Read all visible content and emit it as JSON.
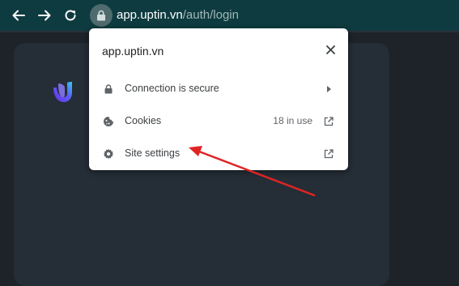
{
  "toolbar": {
    "back_icon": "arrow-left-icon",
    "forward_icon": "arrow-right-icon",
    "reload_icon": "reload-icon",
    "site_info_icon": "tune-lock-icon",
    "url_host": "app.uptin.vn",
    "url_path": "/auth/login"
  },
  "popup": {
    "host": "app.uptin.vn",
    "close_icon": "close-icon",
    "rows": [
      {
        "label": "Connection is secure",
        "icon": "lock-icon",
        "trailing_icon": "chevron-right-icon"
      },
      {
        "label": "Cookies",
        "icon": "cookie-icon",
        "status": "18 in use",
        "trailing_icon": "external-link-icon"
      },
      {
        "label": "Site settings",
        "icon": "gear-icon",
        "trailing_icon": "external-link-icon"
      }
    ]
  },
  "colors": {
    "toolbar_bg": "#0e3b3f",
    "page_bg": "#1d2329",
    "card_bg": "#252d36",
    "popup_bg": "#ffffff",
    "annotation_arrow": "#e02424"
  }
}
